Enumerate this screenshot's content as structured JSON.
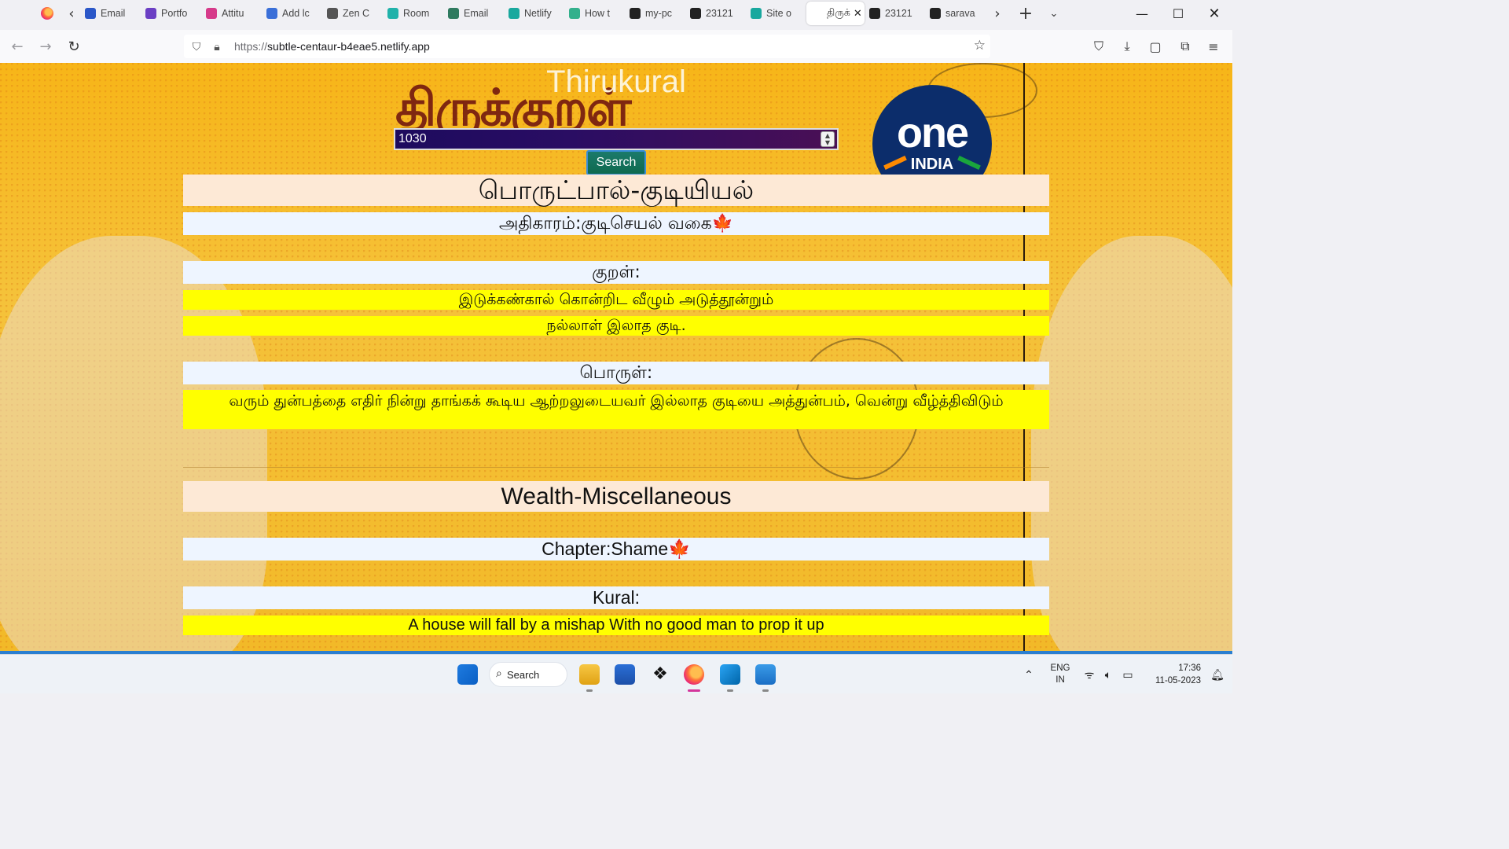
{
  "browser": {
    "tabs": [
      {
        "label": "Email",
        "color": "#2b57c8"
      },
      {
        "label": "Portfo",
        "color": "#6b3fc4"
      },
      {
        "label": "Attitu",
        "color": "#d63a8a"
      },
      {
        "label": "Add lc",
        "color": "#3a6fd8"
      },
      {
        "label": "Zen C",
        "color": "#555555"
      },
      {
        "label": "Room",
        "color": "#20b2aa"
      },
      {
        "label": "Email",
        "color": "#2f7a5f"
      },
      {
        "label": "Netlify",
        "color": "#19a89e"
      },
      {
        "label": "How t",
        "color": "#33b08c"
      },
      {
        "label": "my-pc",
        "color": "#222222"
      },
      {
        "label": "23121",
        "color": "#222222"
      },
      {
        "label": "Site o",
        "color": "#19a89e"
      },
      {
        "label": "திருக்",
        "color": "#ffffff",
        "active": true
      },
      {
        "label": "23121",
        "color": "#222222"
      },
      {
        "label": "sarava",
        "color": "#222222"
      }
    ],
    "url_prefix": "https://",
    "url_host": "subtle-centaur-b4eae5.netlify.app"
  },
  "page": {
    "site_title": "Thirukural",
    "logo_tamil": "திருக்குறள்",
    "logo_one": "one",
    "logo_india": "INDIA",
    "search": {
      "value": "1030",
      "button": "Search"
    },
    "tamil": {
      "section": "பொருட்பால்-குடியியல்",
      "chapter": "அதிகாரம்:குடிசெயல் வகை",
      "kural_label": "குறள்:",
      "kural_line1": "இடுக்கண்கால் கொன்றிட வீழும் அடுத்தூன்றும்",
      "kural_line2": "நல்லாள் இலாத குடி.",
      "meaning_label": "பொருள்:",
      "meaning": "வரும் துன்பத்தை எதிர் நின்று தாங்கக் கூடிய ஆற்றலுடையவர் இல்லாத குடியை அத்துன்பம், வென்று வீழ்த்திவிடும்"
    },
    "english": {
      "section": "Wealth-Miscellaneous",
      "chapter": "Chapter:Shame",
      "kural_label": "Kural:",
      "kural_line1": "A house will fall by a mishap With no good man to prop it up"
    },
    "leaf_glyph": "🍁"
  },
  "taskbar": {
    "search_label": "Search",
    "lang_line1": "ENG",
    "lang_line2": "IN",
    "time": "17:36",
    "date": "11-05-2023"
  }
}
